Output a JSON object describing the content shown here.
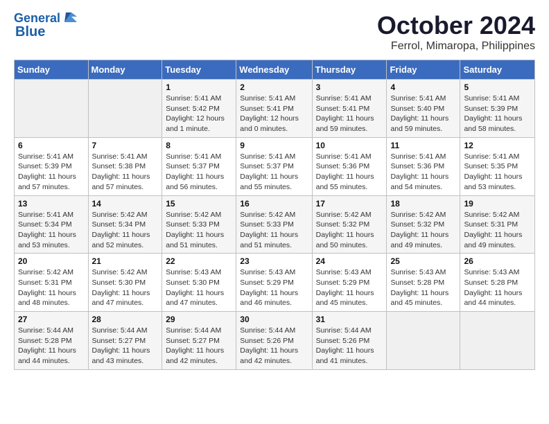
{
  "logo": {
    "line1": "General",
    "line2": "Blue"
  },
  "title": "October 2024",
  "subtitle": "Ferrol, Mimaropa, Philippines",
  "days_of_week": [
    "Sunday",
    "Monday",
    "Tuesday",
    "Wednesday",
    "Thursday",
    "Friday",
    "Saturday"
  ],
  "weeks": [
    [
      {
        "day": "",
        "info": ""
      },
      {
        "day": "",
        "info": ""
      },
      {
        "day": "1",
        "sunrise": "5:41 AM",
        "sunset": "5:42 PM",
        "daylight": "12 hours and 1 minute."
      },
      {
        "day": "2",
        "sunrise": "5:41 AM",
        "sunset": "5:41 PM",
        "daylight": "12 hours and 0 minutes."
      },
      {
        "day": "3",
        "sunrise": "5:41 AM",
        "sunset": "5:41 PM",
        "daylight": "11 hours and 59 minutes."
      },
      {
        "day": "4",
        "sunrise": "5:41 AM",
        "sunset": "5:40 PM",
        "daylight": "11 hours and 59 minutes."
      },
      {
        "day": "5",
        "sunrise": "5:41 AM",
        "sunset": "5:39 PM",
        "daylight": "11 hours and 58 minutes."
      }
    ],
    [
      {
        "day": "6",
        "sunrise": "5:41 AM",
        "sunset": "5:39 PM",
        "daylight": "11 hours and 57 minutes."
      },
      {
        "day": "7",
        "sunrise": "5:41 AM",
        "sunset": "5:38 PM",
        "daylight": "11 hours and 57 minutes."
      },
      {
        "day": "8",
        "sunrise": "5:41 AM",
        "sunset": "5:37 PM",
        "daylight": "11 hours and 56 minutes."
      },
      {
        "day": "9",
        "sunrise": "5:41 AM",
        "sunset": "5:37 PM",
        "daylight": "11 hours and 55 minutes."
      },
      {
        "day": "10",
        "sunrise": "5:41 AM",
        "sunset": "5:36 PM",
        "daylight": "11 hours and 55 minutes."
      },
      {
        "day": "11",
        "sunrise": "5:41 AM",
        "sunset": "5:36 PM",
        "daylight": "11 hours and 54 minutes."
      },
      {
        "day": "12",
        "sunrise": "5:41 AM",
        "sunset": "5:35 PM",
        "daylight": "11 hours and 53 minutes."
      }
    ],
    [
      {
        "day": "13",
        "sunrise": "5:41 AM",
        "sunset": "5:34 PM",
        "daylight": "11 hours and 53 minutes."
      },
      {
        "day": "14",
        "sunrise": "5:42 AM",
        "sunset": "5:34 PM",
        "daylight": "11 hours and 52 minutes."
      },
      {
        "day": "15",
        "sunrise": "5:42 AM",
        "sunset": "5:33 PM",
        "daylight": "11 hours and 51 minutes."
      },
      {
        "day": "16",
        "sunrise": "5:42 AM",
        "sunset": "5:33 PM",
        "daylight": "11 hours and 51 minutes."
      },
      {
        "day": "17",
        "sunrise": "5:42 AM",
        "sunset": "5:32 PM",
        "daylight": "11 hours and 50 minutes."
      },
      {
        "day": "18",
        "sunrise": "5:42 AM",
        "sunset": "5:32 PM",
        "daylight": "11 hours and 49 minutes."
      },
      {
        "day": "19",
        "sunrise": "5:42 AM",
        "sunset": "5:31 PM",
        "daylight": "11 hours and 49 minutes."
      }
    ],
    [
      {
        "day": "20",
        "sunrise": "5:42 AM",
        "sunset": "5:31 PM",
        "daylight": "11 hours and 48 minutes."
      },
      {
        "day": "21",
        "sunrise": "5:42 AM",
        "sunset": "5:30 PM",
        "daylight": "11 hours and 47 minutes."
      },
      {
        "day": "22",
        "sunrise": "5:43 AM",
        "sunset": "5:30 PM",
        "daylight": "11 hours and 47 minutes."
      },
      {
        "day": "23",
        "sunrise": "5:43 AM",
        "sunset": "5:29 PM",
        "daylight": "11 hours and 46 minutes."
      },
      {
        "day": "24",
        "sunrise": "5:43 AM",
        "sunset": "5:29 PM",
        "daylight": "11 hours and 45 minutes."
      },
      {
        "day": "25",
        "sunrise": "5:43 AM",
        "sunset": "5:28 PM",
        "daylight": "11 hours and 45 minutes."
      },
      {
        "day": "26",
        "sunrise": "5:43 AM",
        "sunset": "5:28 PM",
        "daylight": "11 hours and 44 minutes."
      }
    ],
    [
      {
        "day": "27",
        "sunrise": "5:44 AM",
        "sunset": "5:28 PM",
        "daylight": "11 hours and 44 minutes."
      },
      {
        "day": "28",
        "sunrise": "5:44 AM",
        "sunset": "5:27 PM",
        "daylight": "11 hours and 43 minutes."
      },
      {
        "day": "29",
        "sunrise": "5:44 AM",
        "sunset": "5:27 PM",
        "daylight": "11 hours and 42 minutes."
      },
      {
        "day": "30",
        "sunrise": "5:44 AM",
        "sunset": "5:26 PM",
        "daylight": "11 hours and 42 minutes."
      },
      {
        "day": "31",
        "sunrise": "5:44 AM",
        "sunset": "5:26 PM",
        "daylight": "11 hours and 41 minutes."
      },
      {
        "day": "",
        "info": ""
      },
      {
        "day": "",
        "info": ""
      }
    ]
  ]
}
